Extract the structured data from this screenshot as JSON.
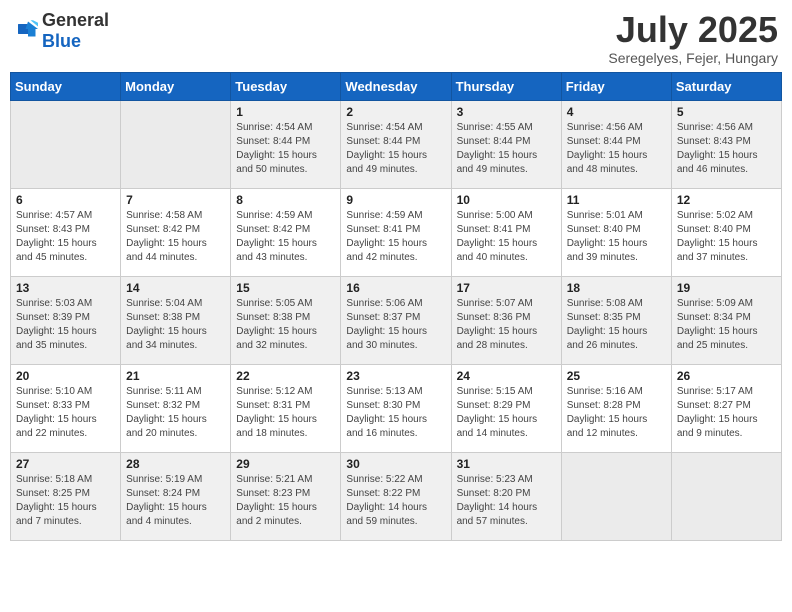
{
  "header": {
    "logo_general": "General",
    "logo_blue": "Blue",
    "month_year": "July 2025",
    "location": "Seregelyes, Fejer, Hungary"
  },
  "weekdays": [
    "Sunday",
    "Monday",
    "Tuesday",
    "Wednesday",
    "Thursday",
    "Friday",
    "Saturday"
  ],
  "weeks": [
    [
      {
        "day": "",
        "sunrise": "",
        "sunset": "",
        "daylight": "",
        "empty": true
      },
      {
        "day": "",
        "sunrise": "",
        "sunset": "",
        "daylight": "",
        "empty": true
      },
      {
        "day": "1",
        "sunrise": "Sunrise: 4:54 AM",
        "sunset": "Sunset: 8:44 PM",
        "daylight": "Daylight: 15 hours and 50 minutes."
      },
      {
        "day": "2",
        "sunrise": "Sunrise: 4:54 AM",
        "sunset": "Sunset: 8:44 PM",
        "daylight": "Daylight: 15 hours and 49 minutes."
      },
      {
        "day": "3",
        "sunrise": "Sunrise: 4:55 AM",
        "sunset": "Sunset: 8:44 PM",
        "daylight": "Daylight: 15 hours and 49 minutes."
      },
      {
        "day": "4",
        "sunrise": "Sunrise: 4:56 AM",
        "sunset": "Sunset: 8:44 PM",
        "daylight": "Daylight: 15 hours and 48 minutes."
      },
      {
        "day": "5",
        "sunrise": "Sunrise: 4:56 AM",
        "sunset": "Sunset: 8:43 PM",
        "daylight": "Daylight: 15 hours and 46 minutes."
      }
    ],
    [
      {
        "day": "6",
        "sunrise": "Sunrise: 4:57 AM",
        "sunset": "Sunset: 8:43 PM",
        "daylight": "Daylight: 15 hours and 45 minutes."
      },
      {
        "day": "7",
        "sunrise": "Sunrise: 4:58 AM",
        "sunset": "Sunset: 8:42 PM",
        "daylight": "Daylight: 15 hours and 44 minutes."
      },
      {
        "day": "8",
        "sunrise": "Sunrise: 4:59 AM",
        "sunset": "Sunset: 8:42 PM",
        "daylight": "Daylight: 15 hours and 43 minutes."
      },
      {
        "day": "9",
        "sunrise": "Sunrise: 4:59 AM",
        "sunset": "Sunset: 8:41 PM",
        "daylight": "Daylight: 15 hours and 42 minutes."
      },
      {
        "day": "10",
        "sunrise": "Sunrise: 5:00 AM",
        "sunset": "Sunset: 8:41 PM",
        "daylight": "Daylight: 15 hours and 40 minutes."
      },
      {
        "day": "11",
        "sunrise": "Sunrise: 5:01 AM",
        "sunset": "Sunset: 8:40 PM",
        "daylight": "Daylight: 15 hours and 39 minutes."
      },
      {
        "day": "12",
        "sunrise": "Sunrise: 5:02 AM",
        "sunset": "Sunset: 8:40 PM",
        "daylight": "Daylight: 15 hours and 37 minutes."
      }
    ],
    [
      {
        "day": "13",
        "sunrise": "Sunrise: 5:03 AM",
        "sunset": "Sunset: 8:39 PM",
        "daylight": "Daylight: 15 hours and 35 minutes."
      },
      {
        "day": "14",
        "sunrise": "Sunrise: 5:04 AM",
        "sunset": "Sunset: 8:38 PM",
        "daylight": "Daylight: 15 hours and 34 minutes."
      },
      {
        "day": "15",
        "sunrise": "Sunrise: 5:05 AM",
        "sunset": "Sunset: 8:38 PM",
        "daylight": "Daylight: 15 hours and 32 minutes."
      },
      {
        "day": "16",
        "sunrise": "Sunrise: 5:06 AM",
        "sunset": "Sunset: 8:37 PM",
        "daylight": "Daylight: 15 hours and 30 minutes."
      },
      {
        "day": "17",
        "sunrise": "Sunrise: 5:07 AM",
        "sunset": "Sunset: 8:36 PM",
        "daylight": "Daylight: 15 hours and 28 minutes."
      },
      {
        "day": "18",
        "sunrise": "Sunrise: 5:08 AM",
        "sunset": "Sunset: 8:35 PM",
        "daylight": "Daylight: 15 hours and 26 minutes."
      },
      {
        "day": "19",
        "sunrise": "Sunrise: 5:09 AM",
        "sunset": "Sunset: 8:34 PM",
        "daylight": "Daylight: 15 hours and 25 minutes."
      }
    ],
    [
      {
        "day": "20",
        "sunrise": "Sunrise: 5:10 AM",
        "sunset": "Sunset: 8:33 PM",
        "daylight": "Daylight: 15 hours and 22 minutes."
      },
      {
        "day": "21",
        "sunrise": "Sunrise: 5:11 AM",
        "sunset": "Sunset: 8:32 PM",
        "daylight": "Daylight: 15 hours and 20 minutes."
      },
      {
        "day": "22",
        "sunrise": "Sunrise: 5:12 AM",
        "sunset": "Sunset: 8:31 PM",
        "daylight": "Daylight: 15 hours and 18 minutes."
      },
      {
        "day": "23",
        "sunrise": "Sunrise: 5:13 AM",
        "sunset": "Sunset: 8:30 PM",
        "daylight": "Daylight: 15 hours and 16 minutes."
      },
      {
        "day": "24",
        "sunrise": "Sunrise: 5:15 AM",
        "sunset": "Sunset: 8:29 PM",
        "daylight": "Daylight: 15 hours and 14 minutes."
      },
      {
        "day": "25",
        "sunrise": "Sunrise: 5:16 AM",
        "sunset": "Sunset: 8:28 PM",
        "daylight": "Daylight: 15 hours and 12 minutes."
      },
      {
        "day": "26",
        "sunrise": "Sunrise: 5:17 AM",
        "sunset": "Sunset: 8:27 PM",
        "daylight": "Daylight: 15 hours and 9 minutes."
      }
    ],
    [
      {
        "day": "27",
        "sunrise": "Sunrise: 5:18 AM",
        "sunset": "Sunset: 8:25 PM",
        "daylight": "Daylight: 15 hours and 7 minutes."
      },
      {
        "day": "28",
        "sunrise": "Sunrise: 5:19 AM",
        "sunset": "Sunset: 8:24 PM",
        "daylight": "Daylight: 15 hours and 4 minutes."
      },
      {
        "day": "29",
        "sunrise": "Sunrise: 5:21 AM",
        "sunset": "Sunset: 8:23 PM",
        "daylight": "Daylight: 15 hours and 2 minutes."
      },
      {
        "day": "30",
        "sunrise": "Sunrise: 5:22 AM",
        "sunset": "Sunset: 8:22 PM",
        "daylight": "Daylight: 14 hours and 59 minutes."
      },
      {
        "day": "31",
        "sunrise": "Sunrise: 5:23 AM",
        "sunset": "Sunset: 8:20 PM",
        "daylight": "Daylight: 14 hours and 57 minutes."
      },
      {
        "day": "",
        "sunrise": "",
        "sunset": "",
        "daylight": "",
        "empty": true
      },
      {
        "day": "",
        "sunrise": "",
        "sunset": "",
        "daylight": "",
        "empty": true
      }
    ]
  ]
}
